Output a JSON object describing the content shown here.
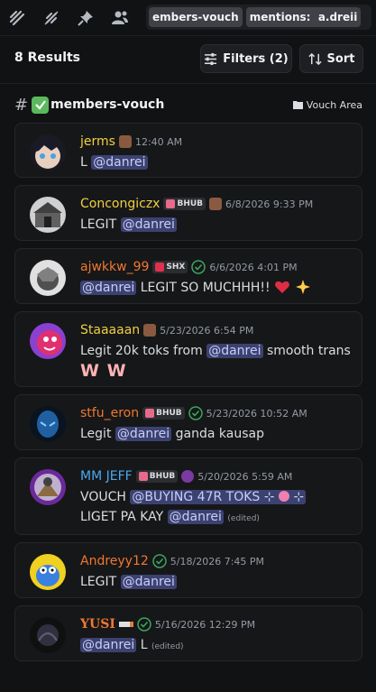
{
  "search": {
    "chip1": "embers-vouch",
    "chip2_key": "mentions:",
    "chip2_val": "a.dreii"
  },
  "results": {
    "count": "8 Results",
    "filters_label": "Filters (2)",
    "sort_label": "Sort"
  },
  "channel": {
    "hash": "#",
    "name": "members-vouch",
    "category": "Vouch Area"
  },
  "colors": {
    "mention_bg": "#3c4270",
    "mention_fg": "#c9cdfb",
    "timestamp": "#949ba4",
    "card_bg": "#161719"
  },
  "messages": [
    {
      "username": "jerms",
      "timestamp": "12:40 AM",
      "text_before": "L ",
      "mention": "@danrei",
      "text_after": ""
    },
    {
      "username": "Concongiczx",
      "tag": "BHUB",
      "timestamp": "6/8/2026 9:33 PM",
      "text_before": "LEGIT ",
      "mention": "@danrei",
      "text_after": ""
    },
    {
      "username": "ajwkkw_99",
      "tag": "SHX",
      "timestamp": "6/6/2026 4:01 PM",
      "mention": "@danrei",
      "text_after": " LEGIT SO MUCHHH!!"
    },
    {
      "username": "Staaaaan",
      "timestamp": "5/23/2026 6:54 PM",
      "text_before": "Legit 20k toks from ",
      "mention": "@danrei",
      "text_after": " smooth trans",
      "line2": "W W"
    },
    {
      "username": "stfu_eron",
      "tag": "BHUB",
      "timestamp": "5/23/2026 10:52 AM",
      "text_before": "Legit ",
      "mention": "@danrei",
      "text_after": "  ganda kausap"
    },
    {
      "username": "MM JEFF",
      "tag": "BHUB",
      "timestamp": "5/20/2026 5:59 AM",
      "text_before": "VOUCH ",
      "mention1": "@BUYING 47R TOKS",
      "line2_before": "LIGET PA KAY ",
      "mention": "@danrei",
      "edited": "(edited)"
    },
    {
      "username": "Andreyy12",
      "timestamp": "5/18/2026 7:45 PM",
      "text_before": "LEGIT ",
      "mention": "@danrei",
      "text_after": ""
    },
    {
      "username": "YUSI",
      "timestamp": "5/16/2026 12:29 PM",
      "mention": "@danrei",
      "text_after": "  L ",
      "edited": "(edited)"
    }
  ]
}
